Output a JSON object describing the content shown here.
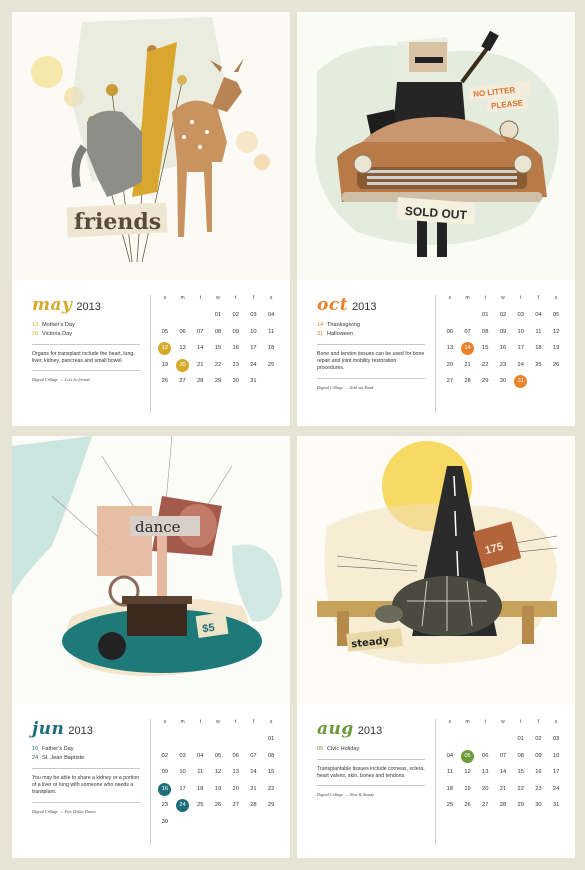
{
  "day_headers": [
    "s",
    "m",
    "t",
    "w",
    "t",
    "f",
    "s"
  ],
  "cards": {
    "may": {
      "month": "may",
      "year": "2013",
      "color": "#d4a92c",
      "art_word": "friends",
      "holidays": [
        {
          "n": "12",
          "t": "Mother's Day"
        },
        {
          "n": "20",
          "t": "Victoria Day"
        }
      ],
      "desc": "Organs for transplant include the heart, lung, liver, kidney, pancreas and small bowel.",
      "credit": "Digital Collage  →  Let's be friends",
      "offset": 3,
      "days": 31,
      "highlights": [
        12,
        20
      ]
    },
    "oct": {
      "month": "oct",
      "year": "2013",
      "color": "#e8822c",
      "art_sign1": "NO LITTER",
      "art_sign2": "PLEASE",
      "art_tag": "SOLD OUT",
      "holidays": [
        {
          "n": "14",
          "t": "Thanksgiving"
        },
        {
          "n": "31",
          "t": "Halloween"
        }
      ],
      "desc": "Bone and tendon tissues can be used for bone repair and joint mobility restoration procedures.",
      "credit": "Digital Collage  →  Sold out Road",
      "offset": 2,
      "days": 31,
      "highlights": [
        14,
        31
      ]
    },
    "jun": {
      "month": "jun",
      "year": "2013",
      "color": "#1f6f7a",
      "art_word": "dance",
      "art_tag": "$5",
      "holidays": [
        {
          "n": "16",
          "t": "Father's Day"
        },
        {
          "n": "24",
          "t": "St. Jean Baptiste"
        }
      ],
      "desc": "You may be able to share a kidney or a portion of a liver or lung with someone who needs a transplant.",
      "credit": "Digital Collage  →  Five Dollar Dance",
      "offset": 6,
      "days": 30,
      "highlights": [
        16,
        24
      ]
    },
    "aug": {
      "month": "aug",
      "year": "2013",
      "color": "#6c9a3a",
      "art_word": "steady",
      "art_tag": "175",
      "holidays": [
        {
          "n": "05",
          "t": "Civic Holiday"
        }
      ],
      "desc": "Transplantable tissues include corneas, sclera, heart valves, skin, bones and tendons.",
      "credit": "Digital Collage  →  Slow & Steady",
      "offset": 4,
      "days": 31,
      "highlights": [
        5
      ]
    }
  }
}
